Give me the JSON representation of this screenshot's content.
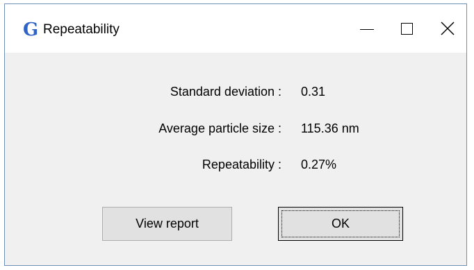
{
  "window": {
    "title": "Repeatability",
    "icon": "app-g-icon",
    "icon_letter": "G",
    "accent_color": "#2f63c6"
  },
  "caption_buttons": {
    "minimize": "minimize-icon",
    "maximize": "maximize-icon",
    "close": "close-icon"
  },
  "results": [
    {
      "label": "Standard deviation :",
      "value": "0.31"
    },
    {
      "label": "Average particle size :",
      "value": "115.36 nm"
    },
    {
      "label": "Repeatability :",
      "value": "0.27%"
    }
  ],
  "buttons": {
    "view_report": "View report",
    "ok": "OK"
  }
}
